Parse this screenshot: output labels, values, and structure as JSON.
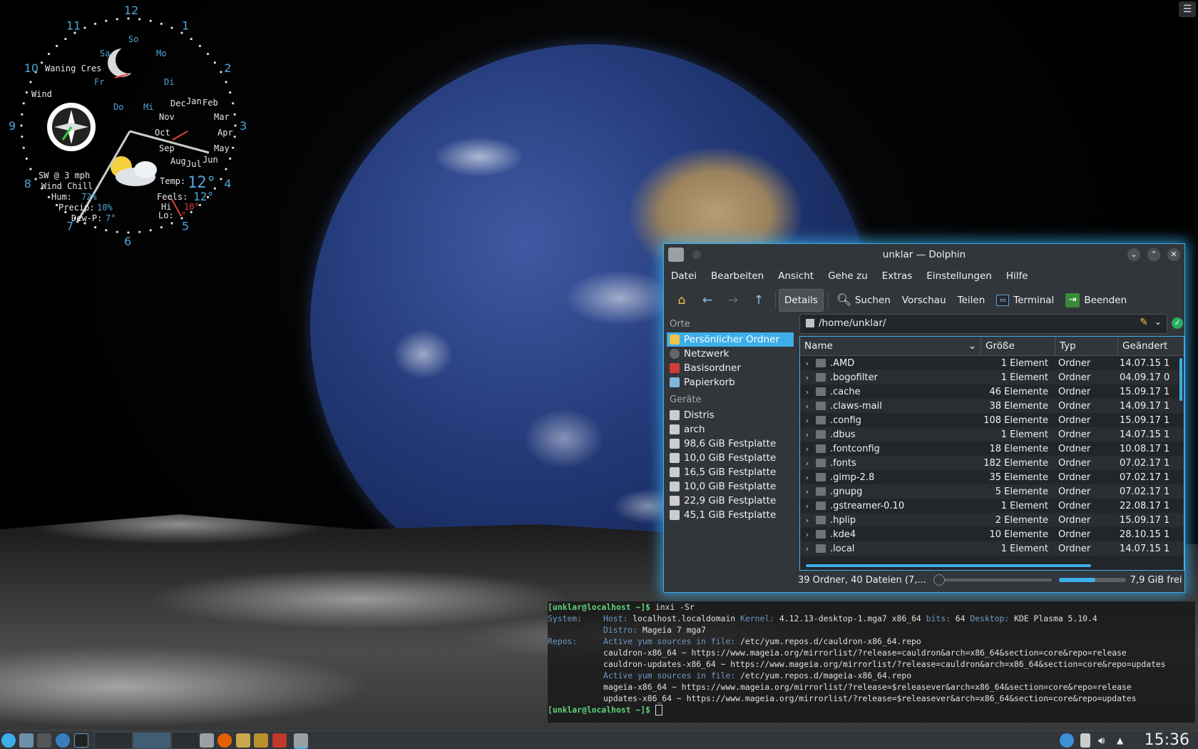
{
  "clock_widget": {
    "hours": [
      "12",
      "1",
      "2",
      "3",
      "4",
      "5",
      "6",
      "7",
      "8",
      "9",
      "10",
      "11"
    ],
    "moon": "Waning Cres",
    "wind_label": "Wind",
    "days": [
      "So",
      "Mo",
      "Di",
      "Mi",
      "Do",
      "Fr",
      "Sa"
    ],
    "months": [
      "Dec",
      "Jan",
      "Feb",
      "Nov",
      "Mar",
      "Oct",
      "Apr",
      "Sep",
      "May",
      "Aug",
      "Jul",
      "Jun"
    ],
    "wind": "SW @ 3 mph",
    "wind_chill": "Wind Chill",
    "hum_label": "Hum:",
    "hum": "72%",
    "precip_label": "Precip:",
    "precip": "10%",
    "dew_label": "Dew-P:",
    "dew": "7°",
    "temp_label": "Temp:",
    "temp": "12°",
    "feels_label": "Feels:",
    "feels": "12°",
    "hi_label": "Hi",
    "hi": "10°",
    "lo_label": "Lo:",
    "lo": "°"
  },
  "desktop": {
    "menu_icon": "☰"
  },
  "window": {
    "title": "unklar — Dolphin",
    "menu": [
      "Datei",
      "Bearbeiten",
      "Ansicht",
      "Gehe zu",
      "Extras",
      "Einstellungen",
      "Hilfe"
    ],
    "toolbar": {
      "details": "Details",
      "search": "Suchen",
      "preview": "Vorschau",
      "share": "Teilen",
      "terminal": "Terminal",
      "quit": "Beenden"
    },
    "places_header": "Orte",
    "places": [
      "Persönlicher Ordner",
      "Netzwerk",
      "Basisordner",
      "Papierkorb"
    ],
    "devices_header": "Geräte",
    "devices": [
      "Distris",
      "arch",
      "98,6 GiB Festplatte",
      "10,0 GiB Festplatte",
      "16,5 GiB Festplatte",
      "10,0 GiB Festplatte",
      "22,9 GiB Festplatte",
      "45,1 GiB Festplatte"
    ],
    "path": "/home/unklar/",
    "columns": {
      "name": "Name",
      "size": "Größe",
      "type": "Typ",
      "modified": "Geändert"
    },
    "files": [
      {
        "name": ".AMD",
        "size": "1 Element",
        "type": "Ordner",
        "date": "14.07.15 1"
      },
      {
        "name": ".bogofilter",
        "size": "1 Element",
        "type": "Ordner",
        "date": "04.09.17 0"
      },
      {
        "name": ".cache",
        "size": "46 Elemente",
        "type": "Ordner",
        "date": "15.09.17 1"
      },
      {
        "name": ".claws-mail",
        "size": "38 Elemente",
        "type": "Ordner",
        "date": "14.09.17 1"
      },
      {
        "name": ".config",
        "size": "108 Elemente",
        "type": "Ordner",
        "date": "15.09.17 1"
      },
      {
        "name": ".dbus",
        "size": "1 Element",
        "type": "Ordner",
        "date": "14.07.15 1"
      },
      {
        "name": ".fontconfig",
        "size": "18 Elemente",
        "type": "Ordner",
        "date": "10.08.17 1"
      },
      {
        "name": ".fonts",
        "size": "182 Elemente",
        "type": "Ordner",
        "date": "07.02.17 1"
      },
      {
        "name": ".gimp-2.8",
        "size": "35 Elemente",
        "type": "Ordner",
        "date": "07.02.17 1"
      },
      {
        "name": ".gnupg",
        "size": "5 Elemente",
        "type": "Ordner",
        "date": "07.02.17 1"
      },
      {
        "name": ".gstreamer-0.10",
        "size": "1 Element",
        "type": "Ordner",
        "date": "22.08.17 1"
      },
      {
        "name": ".hplip",
        "size": "2 Elemente",
        "type": "Ordner",
        "date": "15.09.17 1"
      },
      {
        "name": ".kde4",
        "size": "10 Elemente",
        "type": "Ordner",
        "date": "28.10.15 1"
      },
      {
        "name": ".local",
        "size": "1 Element",
        "type": "Ordner",
        "date": "14.07.15 1"
      }
    ],
    "status_text": "39 Ordner, 40 Dateien (7,...",
    "free_space": "7,9 GiB frei",
    "disk_used_fraction": 0.55
  },
  "terminal": {
    "prompt1": "[unklar@localhost ~]$",
    "cmd1": " inxi -Sr",
    "system_label": "System:",
    "host_label": "Host:",
    "host": " localhost.localdomain ",
    "kernel_label": "Kernel:",
    "kernel": " 4.12.13-desktop-1.mga7 x86_64 ",
    "bits_label": "bits:",
    "bits": " 64 ",
    "desktop_label": "Desktop:",
    "desktop": " KDE Plasma 5.10.4",
    "distro_label": "Distro:",
    "distro": " Mageia 7 mga7",
    "repos_label": "Repos:",
    "active1_label": "Active yum sources in file:",
    "active1": " /etc/yum.repos.d/cauldron-x86_64.repo",
    "repo1": "cauldron-x86_64 ~ https://www.mageia.org/mirrorlist/?release=cauldron&arch=x86_64&section=core&repo=release",
    "repo2": "cauldron-updates-x86_64 ~ https://www.mageia.org/mirrorlist/?release=cauldron&arch=x86_64&section=core&repo=updates",
    "active2_label": "Active yum sources in file:",
    "active2": " /etc/yum.repos.d/mageia-x86_64.repo",
    "repo3": "mageia-x86_64 ~ https://www.mageia.org/mirrorlist/?release=$releasever&arch=x86_64&section=core&repo=release",
    "repo4": "updates-x86_64 ~ https://www.mageia.org/mirrorlist/?release=$releasever&arch=x86_64&section=core&repo=updates",
    "prompt2": "[unklar@localhost ~]$"
  },
  "taskbar": {
    "time": "15:36"
  },
  "colors": {
    "accent": "#3daee9",
    "window_bg": "#31363b",
    "view_bg": "#232629"
  }
}
